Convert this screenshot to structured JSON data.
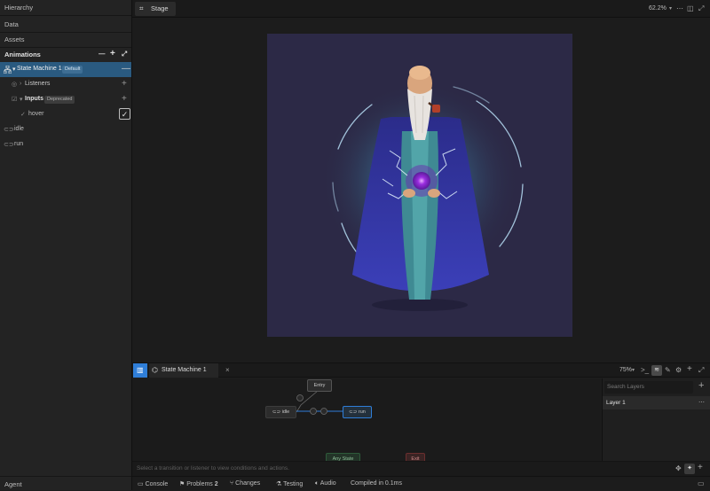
{
  "left_panel": {
    "sections": {
      "hierarchy": "Hierarchy",
      "data": "Data",
      "assets": "Assets",
      "animations": "Animations"
    },
    "state_machine": {
      "label": "State Machine 1",
      "badge": "Default"
    },
    "listeners": {
      "label": "Listeners"
    },
    "inputs": {
      "label": "Inputs",
      "badge": "Deprecated"
    },
    "input_items": [
      {
        "label": "hover",
        "checked": true
      }
    ],
    "animations": [
      {
        "label": "idle"
      },
      {
        "label": "run"
      }
    ],
    "agent": "Agent"
  },
  "stage": {
    "tab": "Stage",
    "zoom": "62.2%"
  },
  "state_machine_panel": {
    "tab": "State Machine 1",
    "zoom": "75%",
    "nodes": {
      "entry": "Entry",
      "idle": "idle",
      "run": "run",
      "any_state": "Any State",
      "exit": "Exit"
    },
    "search_layers_placeholder": "Search Layers",
    "layer": "Layer 1",
    "hint": "Select a transition or listener to view conditions and actions."
  },
  "status_bar": {
    "console": "Console",
    "problems": "Problems",
    "problems_count": "2",
    "changes": "Changes",
    "testing": "Testing",
    "audio": "Audio",
    "compiled": "Compiled in 0.1ms"
  },
  "colors": {
    "accent": "#2f7ed8",
    "selection": "#2a5a80",
    "artboard": "#2c2946"
  }
}
